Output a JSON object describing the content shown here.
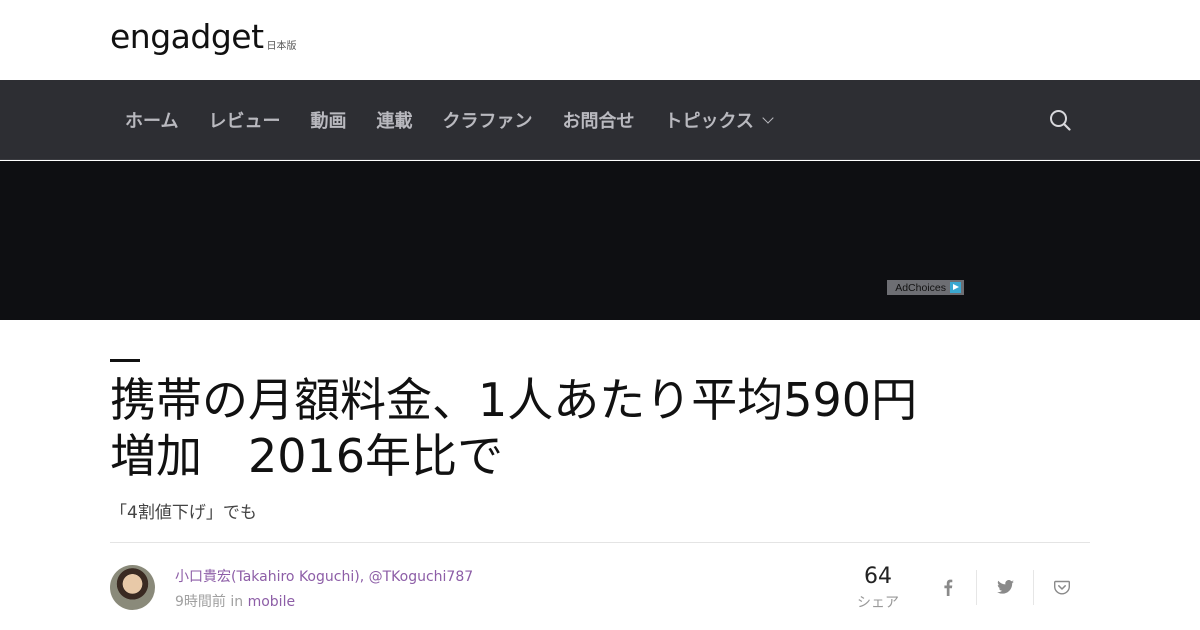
{
  "brand": {
    "logo_text": "engadget",
    "region": "日本版"
  },
  "nav": {
    "items": [
      {
        "label": "ホーム"
      },
      {
        "label": "レビュー"
      },
      {
        "label": "動画"
      },
      {
        "label": "連載"
      },
      {
        "label": "クラファン"
      },
      {
        "label": "お問合せ"
      },
      {
        "label": "トピックス"
      }
    ],
    "search_icon": "search-icon"
  },
  "ad": {
    "adchoices_label": "AdChoices"
  },
  "article": {
    "title_line1": "携帯の月額料金、1人あたり平均590円",
    "title_line2": "増加　2016年比で",
    "subtitle": "「4割値下げ」でも",
    "author_name": "小口貴宏(Takahiro Koguchi)",
    "author_separator": ",",
    "author_handle": "@TKoguchi787",
    "time": "9時間前",
    "in_label": "in",
    "category": "mobile"
  },
  "share": {
    "count": "64",
    "label": "シェア",
    "buttons": [
      "facebook-icon",
      "twitter-icon",
      "pocket-icon"
    ]
  },
  "colors": {
    "nav_bg": "#2d2e33",
    "ad_bg": "#0e0f12",
    "link": "#8d5ea7"
  }
}
